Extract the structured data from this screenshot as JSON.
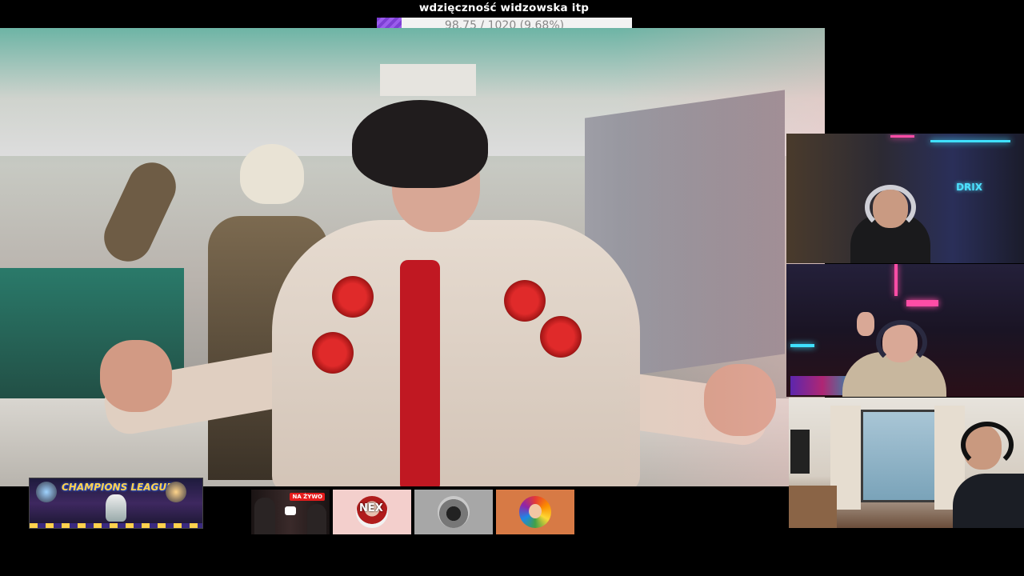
{
  "goal": {
    "title": "wdzięczność widzowska itp",
    "progress_text": "98.75 / 1020 (9.68%)",
    "progress_fraction": 0.0968,
    "fill_color": "#8a4be0"
  },
  "main_video": {
    "description_icon": "music-video-frame"
  },
  "cams": [
    {
      "name": "streamer-cam-1",
      "logo": "DRIX"
    },
    {
      "name": "streamer-cam-2"
    },
    {
      "name": "streamer-cam-3"
    }
  ],
  "bottom_bar": {
    "champions_thumb_title": "CHAMPIONS LEAGUE",
    "live_badge": "NA ŻYWO",
    "avatar1_text": "NEX"
  }
}
